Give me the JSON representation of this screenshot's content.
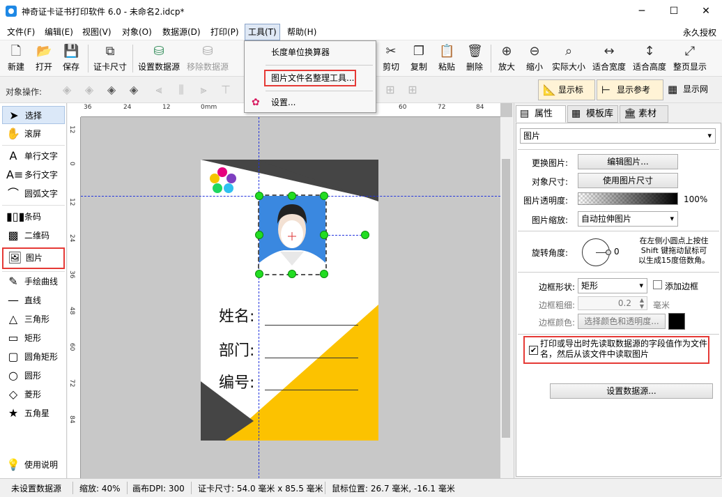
{
  "window": {
    "title": "神奇证卡证书打印软件 6.0 - 未命名2.idcp*",
    "minimize": "─",
    "maximize": "☐",
    "close": "✕"
  },
  "menubar": {
    "items": [
      "文件(F)",
      "编辑(E)",
      "视图(V)",
      "对象(O)",
      "数据源(D)",
      "打印(P)",
      "工具(T)",
      "帮助(H)"
    ],
    "license": "永久授权"
  },
  "tools_menu": {
    "items": [
      "长度单位换算器",
      "图片文件名整理工具...",
      "设置..."
    ]
  },
  "toolbar": {
    "buttons": [
      {
        "label": "新建",
        "icon": "new-file-icon"
      },
      {
        "label": "打开",
        "icon": "open-icon"
      },
      {
        "label": "保存",
        "icon": "save-icon"
      },
      {
        "label": "证卡尺寸",
        "icon": "card-size-icon"
      },
      {
        "label": "设置数据源",
        "icon": "database-icon"
      },
      {
        "label": "移除数据源",
        "icon": "database-remove-icon"
      },
      {
        "label": "剪切",
        "icon": "cut-icon"
      },
      {
        "label": "复制",
        "icon": "copy-icon"
      },
      {
        "label": "粘贴",
        "icon": "paste-icon"
      },
      {
        "label": "删除",
        "icon": "delete-icon"
      },
      {
        "label": "放大",
        "icon": "zoom-in-icon"
      },
      {
        "label": "缩小",
        "icon": "zoom-out-icon"
      },
      {
        "label": "实际大小",
        "icon": "actual-size-icon"
      },
      {
        "label": "适合宽度",
        "icon": "fit-width-icon"
      },
      {
        "label": "适合高度",
        "icon": "fit-height-icon"
      },
      {
        "label": "整页显示",
        "icon": "full-page-icon"
      }
    ]
  },
  "object_toolbar": {
    "label": "对象操作:",
    "show_ruler": "显示标尺",
    "show_guides": "显示参考线",
    "show_grid": "显示网格"
  },
  "left_tools": [
    {
      "label": "选择",
      "icon": "cursor-icon"
    },
    {
      "label": "滚屏",
      "icon": "hand-icon"
    },
    {
      "label": "单行文字",
      "icon": "single-text-icon"
    },
    {
      "label": "多行文字",
      "icon": "multi-text-icon"
    },
    {
      "label": "圆弧文字",
      "icon": "arc-text-icon"
    },
    {
      "label": "条码",
      "icon": "barcode-icon"
    },
    {
      "label": "二维码",
      "icon": "qrcode-icon"
    },
    {
      "label": "图片",
      "icon": "image-icon"
    },
    {
      "label": "手绘曲线",
      "icon": "pencil-icon"
    },
    {
      "label": "直线",
      "icon": "line-icon"
    },
    {
      "label": "三角形",
      "icon": "triangle-icon"
    },
    {
      "label": "矩形",
      "icon": "rectangle-icon"
    },
    {
      "label": "圆角矩形",
      "icon": "rounded-rect-icon"
    },
    {
      "label": "圆形",
      "icon": "circle-icon"
    },
    {
      "label": "菱形",
      "icon": "diamond-icon"
    },
    {
      "label": "五角星",
      "icon": "star-icon"
    },
    {
      "label": "使用说明",
      "icon": "bulb-icon"
    }
  ],
  "ruler": {
    "h_labels": [
      "36",
      "24",
      "12",
      "0mm",
      "60",
      "72",
      "84"
    ],
    "v_labels": [
      "12",
      "0",
      "12",
      "24",
      "36",
      "48",
      "60",
      "72",
      "84"
    ]
  },
  "card": {
    "labels": [
      "姓名:",
      "部门:",
      "编号:"
    ],
    "colors": {
      "dark": "#454545",
      "yellow": "#fcc200",
      "photo_bg": "#3a88e0"
    }
  },
  "right_panel": {
    "tabs": [
      "属性栏",
      "模板库",
      "素材库"
    ],
    "object_type": "图片",
    "replace_label": "更换图片:",
    "edit_image": "编辑图片...",
    "size_label": "对象尺寸:",
    "use_image_size": "使用图片尺寸",
    "opacity_label": "图片透明度:",
    "opacity_value": "100%",
    "opacity_fraction": 1.0,
    "scale_label": "图片缩放:",
    "scale_value": "自动拉伸图片",
    "rotation_label": "旋转角度:",
    "rotation_value": "0",
    "rotation_hint_1": "在左侧小圆点上按住",
    "rotation_hint_2": "Shift 键拖动鼠标可",
    "rotation_hint_3": "以生成15度倍数角。",
    "border_shape_label": "边框形状:",
    "border_shape_value": "矩形",
    "add_border": "添加边框",
    "border_width_label": "边框粗细:",
    "border_width_value": "0.2",
    "border_width_unit": "毫米",
    "border_color_label": "边框颜色:",
    "border_color_btn": "选择颜色和透明度...",
    "datasource_checkbox": "打印或导出时先读取数据源的字段值作为文件名，然后从该文件中读取图片",
    "set_datasource": "设置数据源..."
  },
  "statusbar": {
    "datasource": "未设置数据源",
    "zoom": "缩放: 40%",
    "dpi": "画布DPI: 300",
    "card_size": "证卡尺寸: 54.0 毫米 x 85.5 毫米",
    "mouse": "鼠标位置: 26.7 毫米, -16.1 毫米"
  }
}
